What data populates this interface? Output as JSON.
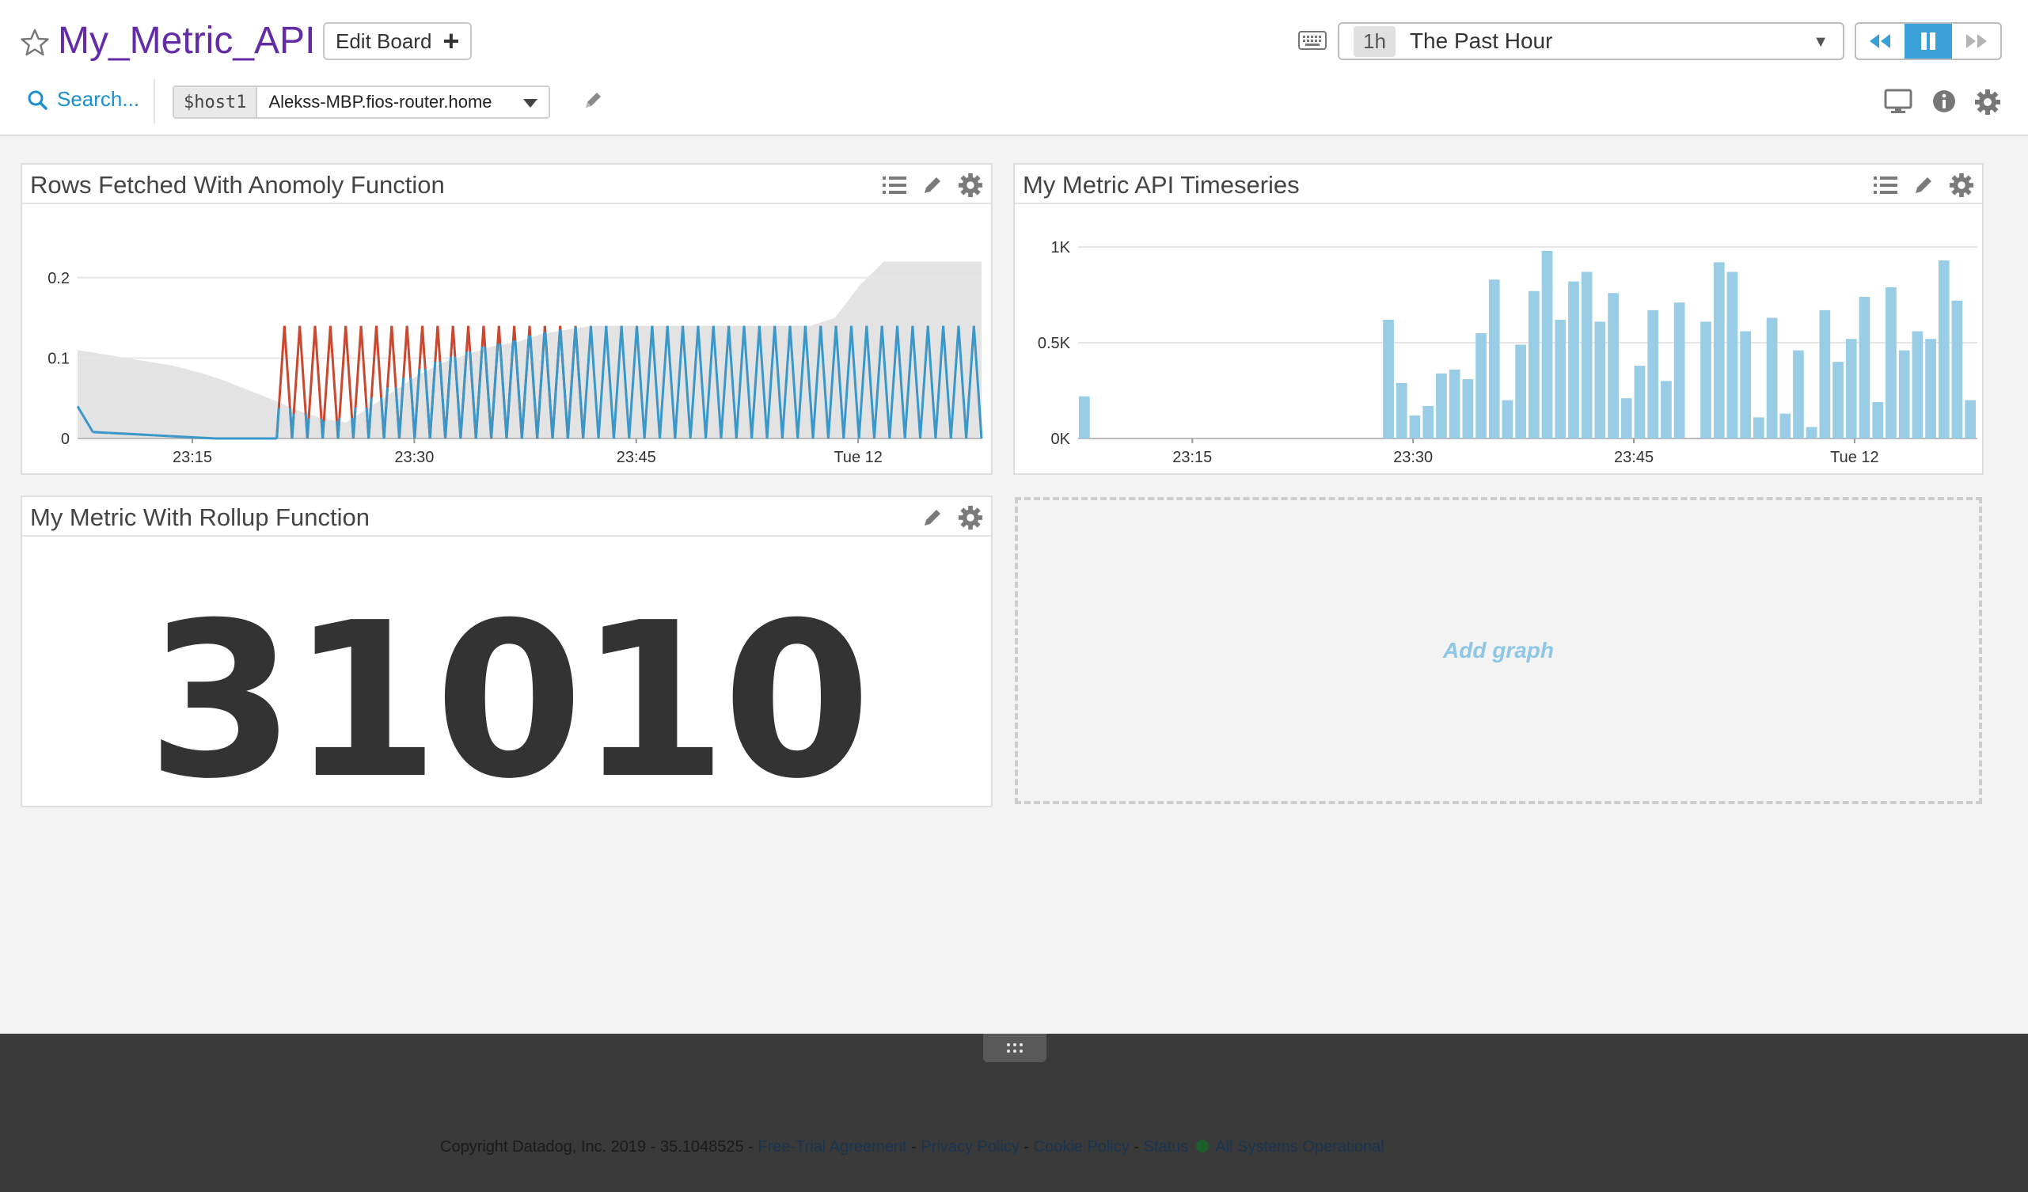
{
  "header": {
    "title": "My_Metric_API",
    "edit_board_label": "Edit Board",
    "time_badge": "1h",
    "time_label": "The Past Hour",
    "search_label": "Search...",
    "template_variable": {
      "name": "$host1",
      "value": "Alekss-MBP.fios-router.home"
    }
  },
  "widgets": {
    "anomaly": {
      "title": "Rows Fetched With Anomoly Function"
    },
    "timeseries": {
      "title": "My Metric API Timeseries"
    },
    "rollup": {
      "title": "My Metric With Rollup Function",
      "value": "31010"
    },
    "add_graph_label": "Add graph"
  },
  "footer": {
    "copyright": "Copyright Datadog, Inc. 2019 - 35.1048525 - ",
    "links": [
      "Free-Trial Agreement",
      "Privacy Policy",
      "Cookie Policy",
      "Status"
    ],
    "separator": " - ",
    "status": "All Systems Operational"
  },
  "colors": {
    "accent": "#632ca6",
    "link": "#1c8fcf",
    "bar": "#99cde6",
    "line_blue": "#3a97c9",
    "line_red": "#c9482f",
    "band": "#e3e3e3"
  },
  "chart_data": [
    {
      "type": "line",
      "title": "Rows Fetched With Anomoly Function",
      "x_ticks": [
        "23:15",
        "23:30",
        "23:45",
        "Tue 12"
      ],
      "y_ticks": [
        "0",
        "0.1",
        "0.2"
      ],
      "ylim": [
        0,
        0.25
      ],
      "series": [
        {
          "values": [
            0.04,
            0.008,
            0.007,
            0.006,
            0.005,
            0.004,
            0.003,
            0.002,
            0.001,
            0,
            0,
            0,
            0,
            0,
            0.14,
            0.14,
            0.14,
            0.14,
            0.14,
            0.14,
            0.14,
            0.14,
            0.14,
            0.14,
            0.14,
            0.14,
            0.14,
            0.14,
            0.14,
            0.14,
            0.14,
            0.14,
            0.14,
            0.14,
            0.14,
            0.14,
            0.14,
            0.14,
            0.14,
            0.14,
            0.14,
            0.14,
            0.14,
            0.14,
            0.14,
            0.14,
            0.14,
            0.14,
            0.14,
            0.14,
            0.14,
            0.14,
            0.14,
            0.14,
            0.14,
            0.14,
            0.14,
            0.14,
            0.14,
            0.14
          ]
        }
      ],
      "band_upper": [
        0.11,
        0.105,
        0.1,
        0.095,
        0.09,
        0.082,
        0.072,
        0.06,
        0.048,
        0.035,
        0.025,
        0.02,
        0.04,
        0.06,
        0.08,
        0.095,
        0.105,
        0.115,
        0.12,
        0.13,
        0.135,
        0.14,
        0.14,
        0.14,
        0.14,
        0.14,
        0.14,
        0.14,
        0.14,
        0.14,
        0.14,
        0.15,
        0.19,
        0.22,
        0.22,
        0.22,
        0.22,
        0.22
      ]
    },
    {
      "type": "bar",
      "title": "My Metric API Timeseries",
      "x_ticks": [
        "23:15",
        "23:30",
        "23:45",
        "Tue 12"
      ],
      "y_ticks": [
        "0K",
        "0.5K",
        "1K"
      ],
      "ylim": [
        0,
        1050
      ],
      "values": [
        220,
        0,
        0,
        0,
        0,
        0,
        0,
        0,
        0,
        0,
        0,
        0,
        0,
        0,
        0,
        0,
        0,
        0,
        0,
        0,
        0,
        0,
        0,
        620,
        290,
        120,
        170,
        340,
        360,
        310,
        550,
        830,
        200,
        490,
        770,
        980,
        620,
        820,
        870,
        610,
        760,
        210,
        380,
        670,
        300,
        710,
        0,
        610,
        920,
        870,
        560,
        110,
        630,
        130,
        460,
        60,
        670,
        400,
        520,
        740,
        190,
        790,
        460,
        560,
        520,
        930,
        720,
        200
      ]
    }
  ]
}
